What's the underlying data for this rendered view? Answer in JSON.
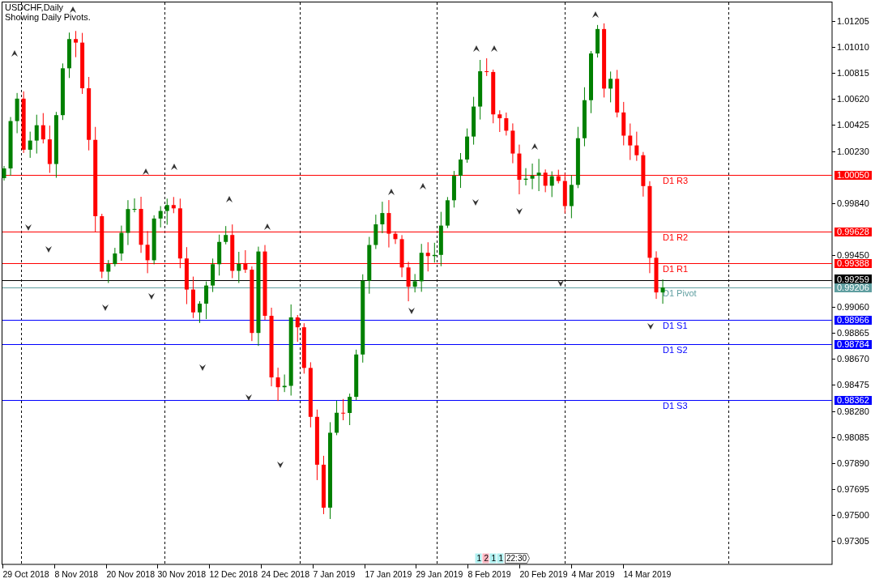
{
  "chart": {
    "title": "USDCHF,Daily",
    "subtitle": "Showing Daily Pivots.",
    "price_axis": [
      "1.01205",
      "1.01010",
      "1.00815",
      "1.00620",
      "1.00425",
      "1.00230",
      "0.99840",
      "0.99450",
      "0.99060",
      "0.98865",
      "0.98670",
      "0.98475",
      "0.98280",
      "0.98085",
      "0.97890",
      "0.97695",
      "0.97500",
      "0.97305"
    ],
    "date_axis": [
      "29 Oct 2018",
      "8 Nov 2018",
      "20 Nov 2018",
      "30 Nov 2018",
      "12 Dec 2018",
      "24 Dec 2018",
      "7 Jan 2019",
      "17 Jan 2019",
      "29 Jan 2019",
      "8 Feb 2019",
      "20 Feb 2019",
      "4 Mar 2019",
      "14 Mar 2019"
    ],
    "pivots": [
      {
        "label": "D1 R3",
        "price": "1.00050",
        "color": "#ff0000"
      },
      {
        "label": "D1 R2",
        "price": "0.99628",
        "color": "#ff0000"
      },
      {
        "label": "D1 R1",
        "price": "0.99388",
        "color": "#ff0000"
      },
      {
        "label": "D1 Pivot",
        "price": "0.99206",
        "color": "#5f9ea0"
      },
      {
        "label": "D1 S1",
        "price": "0.98966",
        "color": "#0000ff"
      },
      {
        "label": "D1 S2",
        "price": "0.98784",
        "color": "#0000ff"
      },
      {
        "label": "D1 S3",
        "price": "0.98362",
        "color": "#0000ff"
      }
    ],
    "current_price": "0.99259",
    "bar_tags": [
      {
        "text": "1",
        "color": "#aff0f0"
      },
      {
        "text": "2",
        "color": "#ffb6c1"
      },
      {
        "text": "1",
        "color": "#aff0f0"
      },
      {
        "text": "1",
        "color": "#aff0f0"
      }
    ],
    "time_tag": "22:30"
  }
}
